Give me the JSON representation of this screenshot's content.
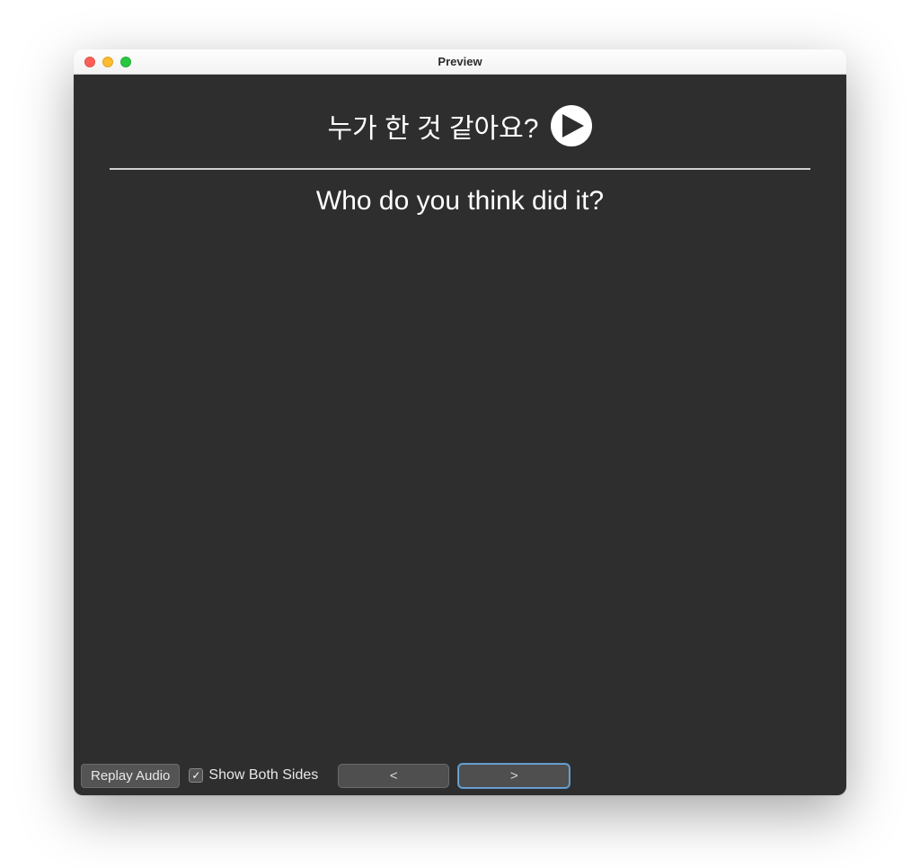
{
  "window": {
    "title": "Preview"
  },
  "card": {
    "front_text": "누가 한 것 같아요?",
    "back_text": "Who do you think did it?"
  },
  "bottom": {
    "replay_audio_label": "Replay Audio",
    "show_both_sides_label": "Show Both Sides",
    "show_both_sides_checked": true,
    "prev_label": "<",
    "next_label": ">"
  },
  "icons": {
    "play": "play-icon",
    "checkmark": "✓"
  },
  "colors": {
    "window_bg": "#2e2e2e",
    "text": "#ffffff",
    "button_bg": "#545454",
    "focus_ring": "#6fa8d8"
  }
}
